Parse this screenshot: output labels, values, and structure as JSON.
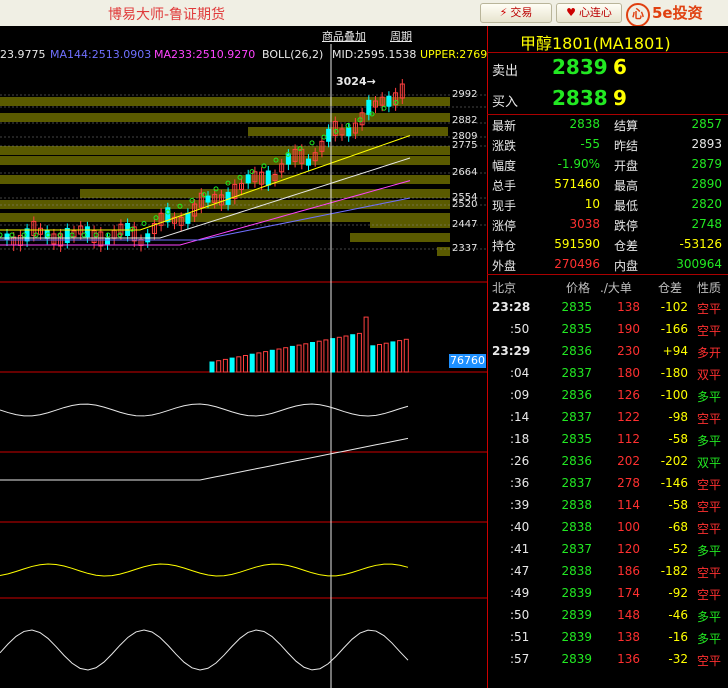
{
  "window": {
    "app_title": "博易大师-鲁证期货",
    "trade_button": "交易",
    "heart_button": "心连心",
    "logo_text": "5e投资"
  },
  "chart_header": {
    "overlay_label": "商品叠加",
    "period_label": "周期"
  },
  "indicators": {
    "ma1": "23.9775",
    "ma144": "MA144:2513.0903",
    "ma233": "MA233:2510.9270",
    "boll": "BOLL(26,2)",
    "mid": "MID:2595.1538",
    "upper": "UPPER:2769"
  },
  "price_axis": {
    "high_mark": "3024→",
    "levels": [
      "2992",
      "2882",
      "2809",
      "2775",
      "2664",
      "2554",
      "2520",
      "2447",
      "2337"
    ]
  },
  "volume_label": "76760",
  "quote": {
    "contract": "甲醇1801(MA1801)",
    "sell_label": "卖出",
    "sell_price": "2839",
    "sell_qty": "6",
    "buy_label": "买入",
    "buy_price": "2838",
    "buy_qty": "9",
    "stats": [
      {
        "l1": "最新",
        "v1": "2838",
        "c1": "green",
        "l2": "结算",
        "v2": "2857",
        "c2": "green"
      },
      {
        "l1": "涨跌",
        "v1": "-55",
        "c1": "green",
        "l2": "昨结",
        "v2": "2893",
        "c2": "white"
      },
      {
        "l1": "幅度",
        "v1": "-1.90%",
        "c1": "green",
        "l2": "开盘",
        "v2": "2879",
        "c2": "green"
      },
      {
        "l1": "总手",
        "v1": "571460",
        "c1": "yellow",
        "l2": "最高",
        "v2": "2890",
        "c2": "green"
      },
      {
        "l1": "现手",
        "v1": "10",
        "c1": "yellow",
        "l2": "最低",
        "v2": "2820",
        "c2": "green"
      },
      {
        "l1": "涨停",
        "v1": "3038",
        "c1": "red",
        "l2": "跌停",
        "v2": "2748",
        "c2": "green"
      },
      {
        "l1": "持仓",
        "v1": "591590",
        "c1": "yellow",
        "l2": "仓差",
        "v2": "-53126",
        "c2": "yellow"
      },
      {
        "l1": "外盘",
        "v1": "270496",
        "c1": "red",
        "l2": "内盘",
        "v2": "300964",
        "c2": "green"
      }
    ],
    "trade_header": {
      "time": "北京",
      "price": "价格",
      "vol": "./大单",
      "diff": "仓差",
      "type": "性质"
    },
    "trades": [
      {
        "t": "23:28",
        "p": "2835",
        "v": "138",
        "d": "-102",
        "k": "空平",
        "kc": "red"
      },
      {
        "t": ":50",
        "p": "2835",
        "v": "190",
        "d": "-166",
        "k": "空平",
        "kc": "red"
      },
      {
        "t": "23:29",
        "p": "2836",
        "v": "230",
        "d": "+94",
        "k": "多开",
        "kc": "red"
      },
      {
        "t": ":04",
        "p": "2837",
        "v": "180",
        "d": "-180",
        "k": "双平",
        "kc": "red"
      },
      {
        "t": ":09",
        "p": "2836",
        "v": "126",
        "d": "-100",
        "k": "多平",
        "kc": "green"
      },
      {
        "t": ":14",
        "p": "2837",
        "v": "122",
        "d": "-98",
        "k": "空平",
        "kc": "red"
      },
      {
        "t": ":18",
        "p": "2835",
        "v": "112",
        "d": "-58",
        "k": "多平",
        "kc": "green"
      },
      {
        "t": ":26",
        "p": "2836",
        "v": "202",
        "d": "-202",
        "k": "双平",
        "kc": "green"
      },
      {
        "t": ":36",
        "p": "2837",
        "v": "278",
        "d": "-146",
        "k": "空平",
        "kc": "red"
      },
      {
        "t": ":39",
        "p": "2838",
        "v": "114",
        "d": "-58",
        "k": "空平",
        "kc": "red"
      },
      {
        "t": ":40",
        "p": "2838",
        "v": "100",
        "d": "-68",
        "k": "空平",
        "kc": "red"
      },
      {
        "t": ":41",
        "p": "2837",
        "v": "120",
        "d": "-52",
        "k": "多平",
        "kc": "green"
      },
      {
        "t": ":47",
        "p": "2838",
        "v": "186",
        "d": "-182",
        "k": "空平",
        "kc": "red"
      },
      {
        "t": ":49",
        "p": "2839",
        "v": "174",
        "d": "-92",
        "k": "空平",
        "kc": "red"
      },
      {
        "t": ":50",
        "p": "2839",
        "v": "148",
        "d": "-46",
        "k": "多平",
        "kc": "green"
      },
      {
        "t": ":51",
        "p": "2839",
        "v": "138",
        "d": "-16",
        "k": "多平",
        "kc": "green"
      },
      {
        "t": ":57",
        "p": "2839",
        "v": "136",
        "d": "-32",
        "k": "空平",
        "kc": "red"
      }
    ]
  }
}
